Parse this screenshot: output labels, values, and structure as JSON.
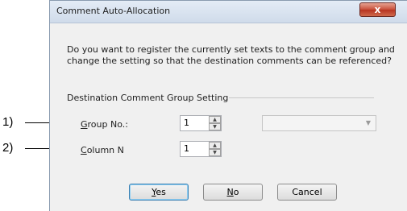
{
  "callouts": [
    {
      "label": "1)"
    },
    {
      "label": "2)"
    }
  ],
  "dialog": {
    "title": "Comment Auto-Allocation",
    "close_glyph": "x",
    "message_line1": "Do you want to register the currently set texts to the comment group and",
    "message_line2": "change the setting so that the destination comments can be referenced?",
    "group_title": "Destination Comment Group Setting",
    "group_no": {
      "mnemonic": "G",
      "label_rest": "roup No.:",
      "value": "1"
    },
    "column": {
      "mnemonic": "C",
      "label_rest": "olumn N",
      "value": "1"
    },
    "combo_value": "",
    "buttons": {
      "yes": {
        "mnemonic": "Y",
        "rest": "es"
      },
      "no": {
        "mnemonic": "N",
        "rest": "o"
      },
      "cancel": {
        "label": "Cancel"
      }
    }
  }
}
